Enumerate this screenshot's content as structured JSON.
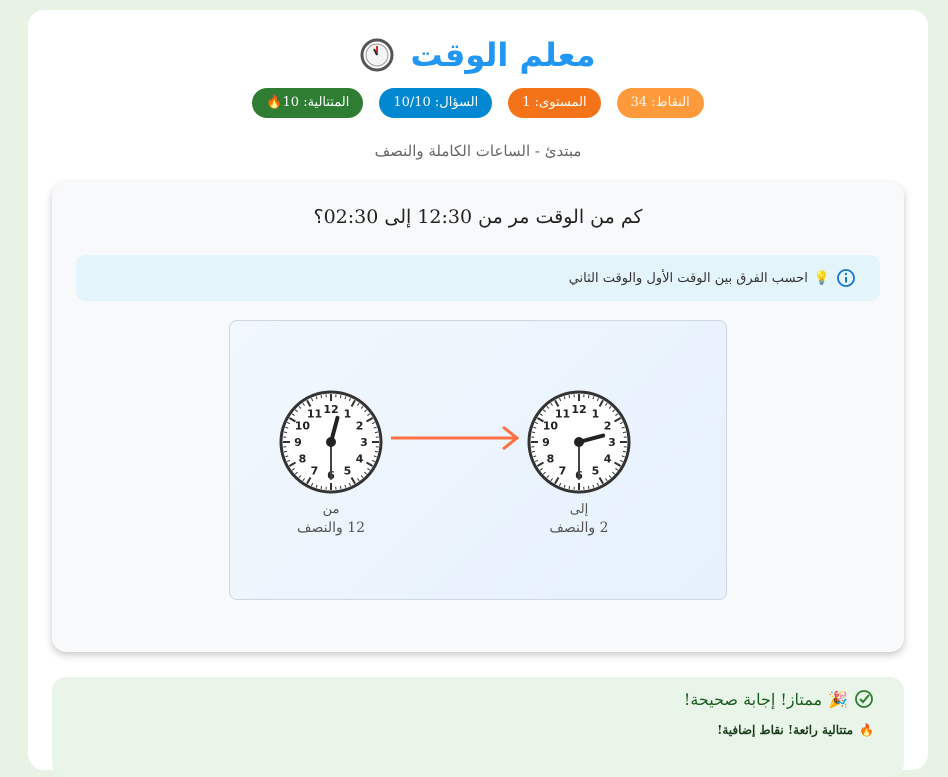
{
  "app": {
    "title": "معلم الوقت",
    "subtitle": "مبتدئ - الساعات الكاملة والنصف"
  },
  "stats": {
    "points": "النقاط: 34",
    "level": "المستوى: 1",
    "question": "السؤال: 10/10",
    "streak": "المتتالية: 10🔥"
  },
  "colors": {
    "points_badge": "#ff9a3c",
    "level_badge": "#f47318",
    "question_badge": "#0288d1",
    "streak_badge": "#2e7d32",
    "accent": "#2196f3",
    "arrow": "#ff7043"
  },
  "question": {
    "text": "كم من الوقت مر من 12:30 إلى 02:30؟",
    "hint": "احسب الفرق بين الوقت الأول والوقت الثاني",
    "hint_emoji": "💡"
  },
  "clocks": {
    "from": {
      "label": "من",
      "time_text": "12 والنصف",
      "hour": 12,
      "minute": 30
    },
    "to": {
      "label": "إلى",
      "time_text": "2 والنصف",
      "hour": 2,
      "minute": 30
    }
  },
  "feedback": {
    "main": "ممتاز! إجابة صحيحة!",
    "main_emoji": "🎉",
    "streak_message": "متتالية رائعة! نقاط إضافية!",
    "streak_emoji": "🔥"
  },
  "icons": {
    "title": "clock-icon",
    "hint": "info-icon",
    "feedback": "check-circle-icon"
  }
}
